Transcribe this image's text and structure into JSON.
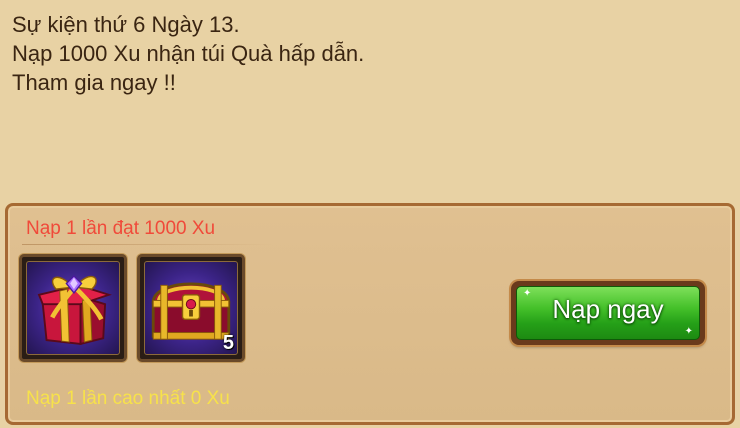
{
  "event": {
    "lines": [
      "Sự kiện thứ 6 Ngày 13.",
      "Nạp 1000 Xu nhận túi Quà hấp dẫn.",
      "Tham gia ngay !!"
    ]
  },
  "reward_panel": {
    "requirement": "Nạp 1 lần đạt 1000 Xu",
    "rewards": [
      {
        "icon": "gift-box-icon"
      },
      {
        "icon": "treasure-chest-icon",
        "quantity": "5"
      }
    ],
    "button_label": "Nạp ngay",
    "best_topup": "Nạp 1 lần cao nhất 0 Xu"
  },
  "colors": {
    "background": "#e8d2a4",
    "requirement_text": "#f04a3a",
    "best_text": "#f7e24a",
    "button_green": "#45c12a"
  }
}
